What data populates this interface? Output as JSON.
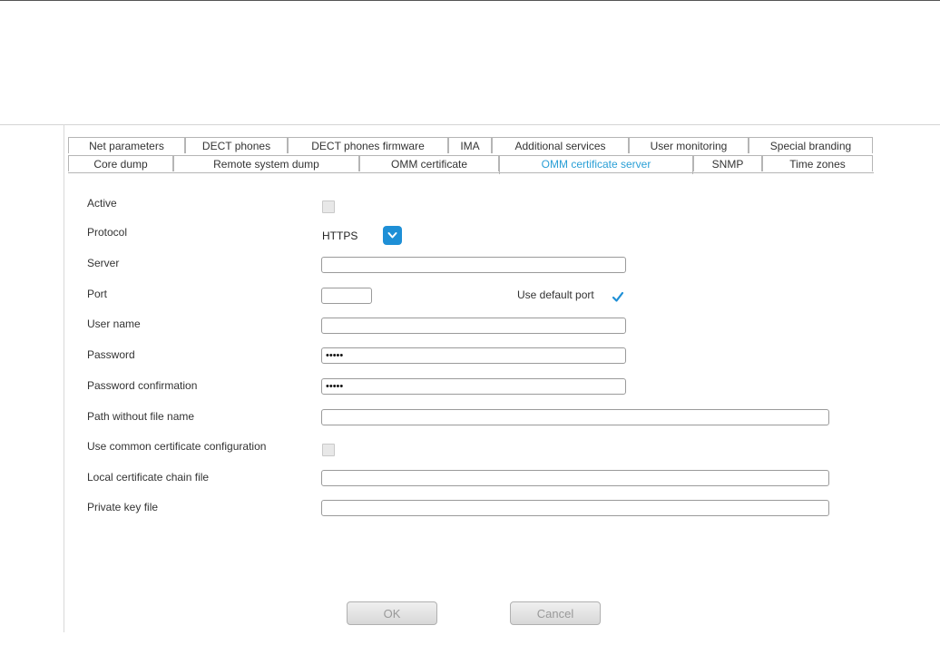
{
  "tabs": {
    "row1": [
      "Net parameters",
      "DECT phones",
      "DECT phones firmware",
      "IMA",
      "Additional services",
      "User monitoring",
      "Special branding"
    ],
    "row2": [
      "Core dump",
      "Remote system dump",
      "OMM certificate",
      "OMM certificate server",
      "SNMP",
      "Time zones"
    ],
    "active": "OMM certificate server"
  },
  "form": {
    "active_label": "Active",
    "protocol_label": "Protocol",
    "protocol_value": "HTTPS",
    "server_label": "Server",
    "server_value": "",
    "port_label": "Port",
    "port_value": "",
    "use_default_port_label": "Use default port",
    "use_default_port_checked": true,
    "user_name_label": "User name",
    "user_name_value": "",
    "password_label": "Password",
    "password_value": "•••••",
    "password_confirmation_label": "Password confirmation",
    "password_confirmation_value": "•••••",
    "path_label": "Path without file name",
    "path_value": "",
    "use_common_cert_label": "Use common certificate configuration",
    "local_cert_chain_label": "Local certificate chain file",
    "local_cert_chain_value": "",
    "private_key_label": "Private key file",
    "private_key_value": ""
  },
  "buttons": {
    "ok_label": "OK",
    "cancel_label": "Cancel"
  },
  "colors": {
    "accent": "#1e8fd6",
    "active_tab_text": "#2a9fd6"
  }
}
